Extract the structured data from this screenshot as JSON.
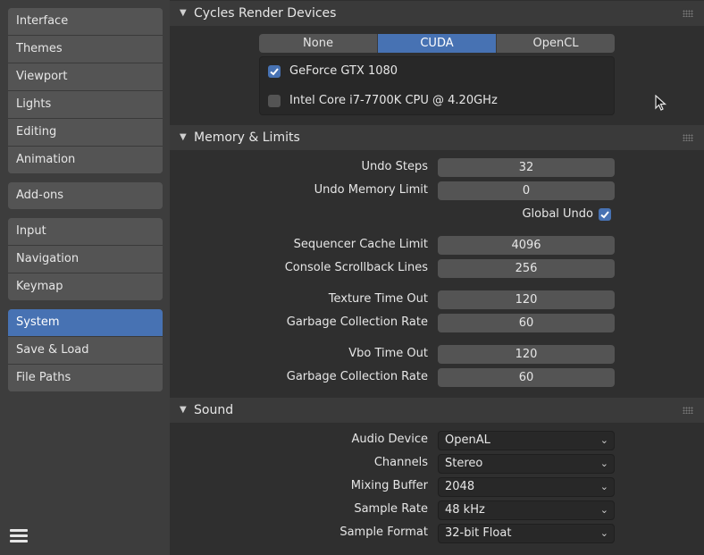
{
  "sidebar": {
    "group1": [
      "Interface",
      "Themes",
      "Viewport",
      "Lights",
      "Editing",
      "Animation"
    ],
    "group2": [
      "Add-ons"
    ],
    "group3": [
      "Input",
      "Navigation",
      "Keymap"
    ],
    "group4": [
      "System",
      "Save & Load",
      "File Paths"
    ],
    "active": "System"
  },
  "cycles": {
    "title": "Cycles Render Devices",
    "tabs": [
      "None",
      "CUDA",
      "OpenCL"
    ],
    "active_tab": "CUDA",
    "devices": [
      {
        "name": "GeForce GTX 1080",
        "checked": true
      },
      {
        "name": "Intel Core i7-7700K CPU @ 4.20GHz",
        "checked": false
      }
    ]
  },
  "memory": {
    "title": "Memory & Limits",
    "undo_steps_label": "Undo Steps",
    "undo_steps": "32",
    "undo_memory_label": "Undo Memory Limit",
    "undo_memory": "0",
    "global_undo_label": "Global Undo",
    "global_undo": true,
    "seq_cache_label": "Sequencer Cache Limit",
    "seq_cache": "4096",
    "console_label": "Console Scrollback Lines",
    "console": "256",
    "tex_timeout_label": "Texture Time Out",
    "tex_timeout": "120",
    "tex_gc_label": "Garbage Collection Rate",
    "tex_gc": "60",
    "vbo_timeout_label": "Vbo Time Out",
    "vbo_timeout": "120",
    "vbo_gc_label": "Garbage Collection Rate",
    "vbo_gc": "60"
  },
  "sound": {
    "title": "Sound",
    "audio_device_label": "Audio Device",
    "audio_device": "OpenAL",
    "channels_label": "Channels",
    "channels": "Stereo",
    "mixing_buffer_label": "Mixing Buffer",
    "mixing_buffer": "2048",
    "sample_rate_label": "Sample Rate",
    "sample_rate": "48 kHz",
    "sample_format_label": "Sample Format",
    "sample_format": "32-bit Float"
  },
  "icons": {
    "collapse": "triangle-down-icon",
    "menu": "hamburger-menu-icon",
    "dropdown": "chevron-down-icon",
    "checkbox": "checkmark-icon",
    "grip": "drag-grip-icon",
    "cursor": "mouse-pointer-icon"
  },
  "colors": {
    "accent": "#4772b3",
    "panel_bg": "#2f2f2f",
    "header_bg": "#3a3a3a",
    "widget_bg": "#545454",
    "dropdown_bg": "#282828"
  }
}
